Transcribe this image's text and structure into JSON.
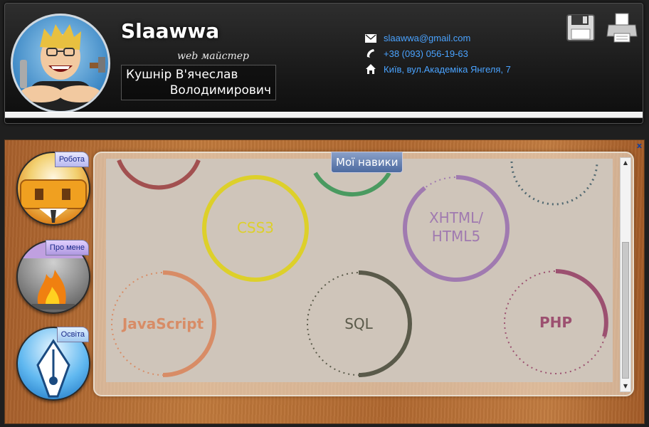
{
  "header": {
    "brand": "Slaawwa",
    "subtitle": "web майстер",
    "name_line1": "Кушнір В'ячеслав",
    "name_line2": "Володимирович",
    "contacts": {
      "email": "slaawwa@gmail.com",
      "phone": "+38 (093) 056-19-63",
      "address": "Київ, вул.Академіка Янгеля, 7"
    },
    "icons": [
      "mail-icon",
      "phone-icon",
      "home-icon",
      "save-icon",
      "print-icon"
    ]
  },
  "panel": {
    "close_label": "x",
    "nav": [
      {
        "label": "Робота",
        "icon": "work-icon"
      },
      {
        "label": "Про мене",
        "icon": "fire-icon"
      },
      {
        "label": "Освіта",
        "icon": "pen-icon"
      }
    ],
    "section_title": "Мої навики",
    "skills": [
      {
        "label": "CSS3",
        "color": "#e0d22c"
      },
      {
        "label": "XHTML/",
        "label2": "HTML5",
        "color": "#a07ab0"
      },
      {
        "label": "JavaScript",
        "color": "#d88c66"
      },
      {
        "label": "SQL",
        "color": "#5a5a4a"
      },
      {
        "label": "PHP",
        "color": "#9c5070"
      }
    ]
  }
}
